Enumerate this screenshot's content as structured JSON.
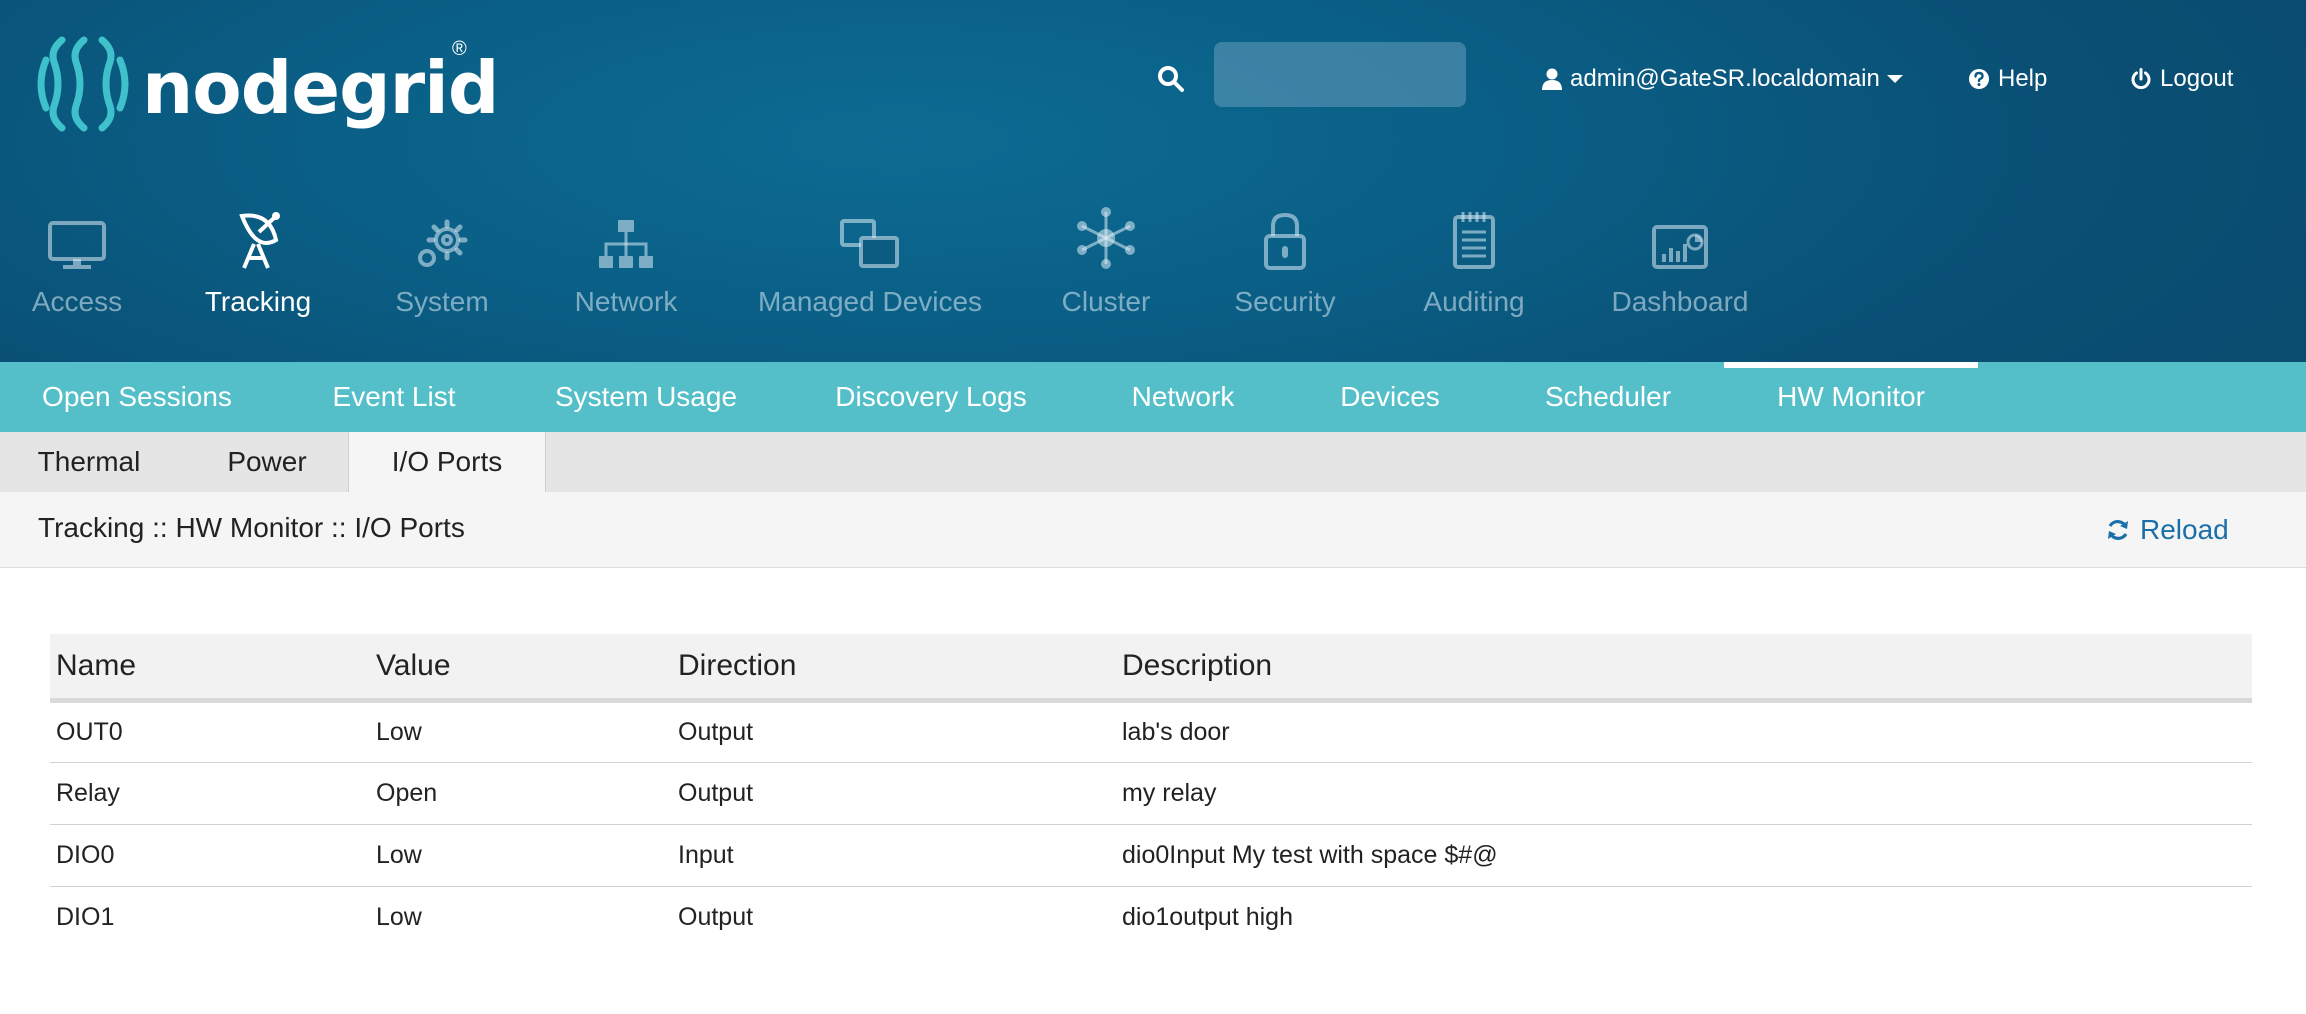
{
  "header": {
    "logo_text": "nodegrid",
    "logo_reg": "®",
    "search": {
      "placeholder": "",
      "value": ""
    },
    "user_label": "admin@GateSR.localdomain",
    "help_label": "Help",
    "logout_label": "Logout"
  },
  "main_nav": [
    {
      "label": "Access",
      "icon": "monitor-icon",
      "active": false
    },
    {
      "label": "Tracking",
      "icon": "satellite-dish-icon",
      "active": true
    },
    {
      "label": "System",
      "icon": "gear-icon",
      "active": false
    },
    {
      "label": "Network",
      "icon": "network-tree-icon",
      "active": false
    },
    {
      "label": "Managed Devices",
      "icon": "devices-icon",
      "active": false
    },
    {
      "label": "Cluster",
      "icon": "cluster-icon",
      "active": false
    },
    {
      "label": "Security",
      "icon": "lock-icon",
      "active": false
    },
    {
      "label": "Auditing",
      "icon": "notepad-icon",
      "active": false
    },
    {
      "label": "Dashboard",
      "icon": "dashboard-icon",
      "active": false
    }
  ],
  "sub_nav": [
    {
      "label": "Open Sessions",
      "active": false
    },
    {
      "label": "Event List",
      "active": false
    },
    {
      "label": "System Usage",
      "active": false
    },
    {
      "label": "Discovery Logs",
      "active": false
    },
    {
      "label": "Network",
      "active": false
    },
    {
      "label": "Devices",
      "active": false
    },
    {
      "label": "Scheduler",
      "active": false
    },
    {
      "label": "HW Monitor",
      "active": true
    }
  ],
  "tabs": [
    {
      "label": "Thermal",
      "active": false
    },
    {
      "label": "Power",
      "active": false
    },
    {
      "label": "I/O Ports",
      "active": true
    }
  ],
  "breadcrumb": "Tracking :: HW Monitor :: I/O Ports",
  "reload_label": "Reload",
  "table": {
    "columns": [
      "Name",
      "Value",
      "Direction",
      "Description"
    ],
    "rows": [
      [
        "OUT0",
        "Low",
        "Output",
        "lab's door"
      ],
      [
        "Relay",
        "Open",
        "Output",
        "my relay"
      ],
      [
        "DIO0",
        "Low",
        "Input",
        "dio0Input My test with space $#@"
      ],
      [
        "DIO1",
        "Low",
        "Output",
        "dio1output high"
      ]
    ]
  },
  "colors": {
    "header_bg": "#0a5f86",
    "subnav_bg": "#55bfc9",
    "tabbar_bg": "#e5e5e5",
    "crumb_bg": "#f5f5f5",
    "link": "#1a6fa8"
  }
}
